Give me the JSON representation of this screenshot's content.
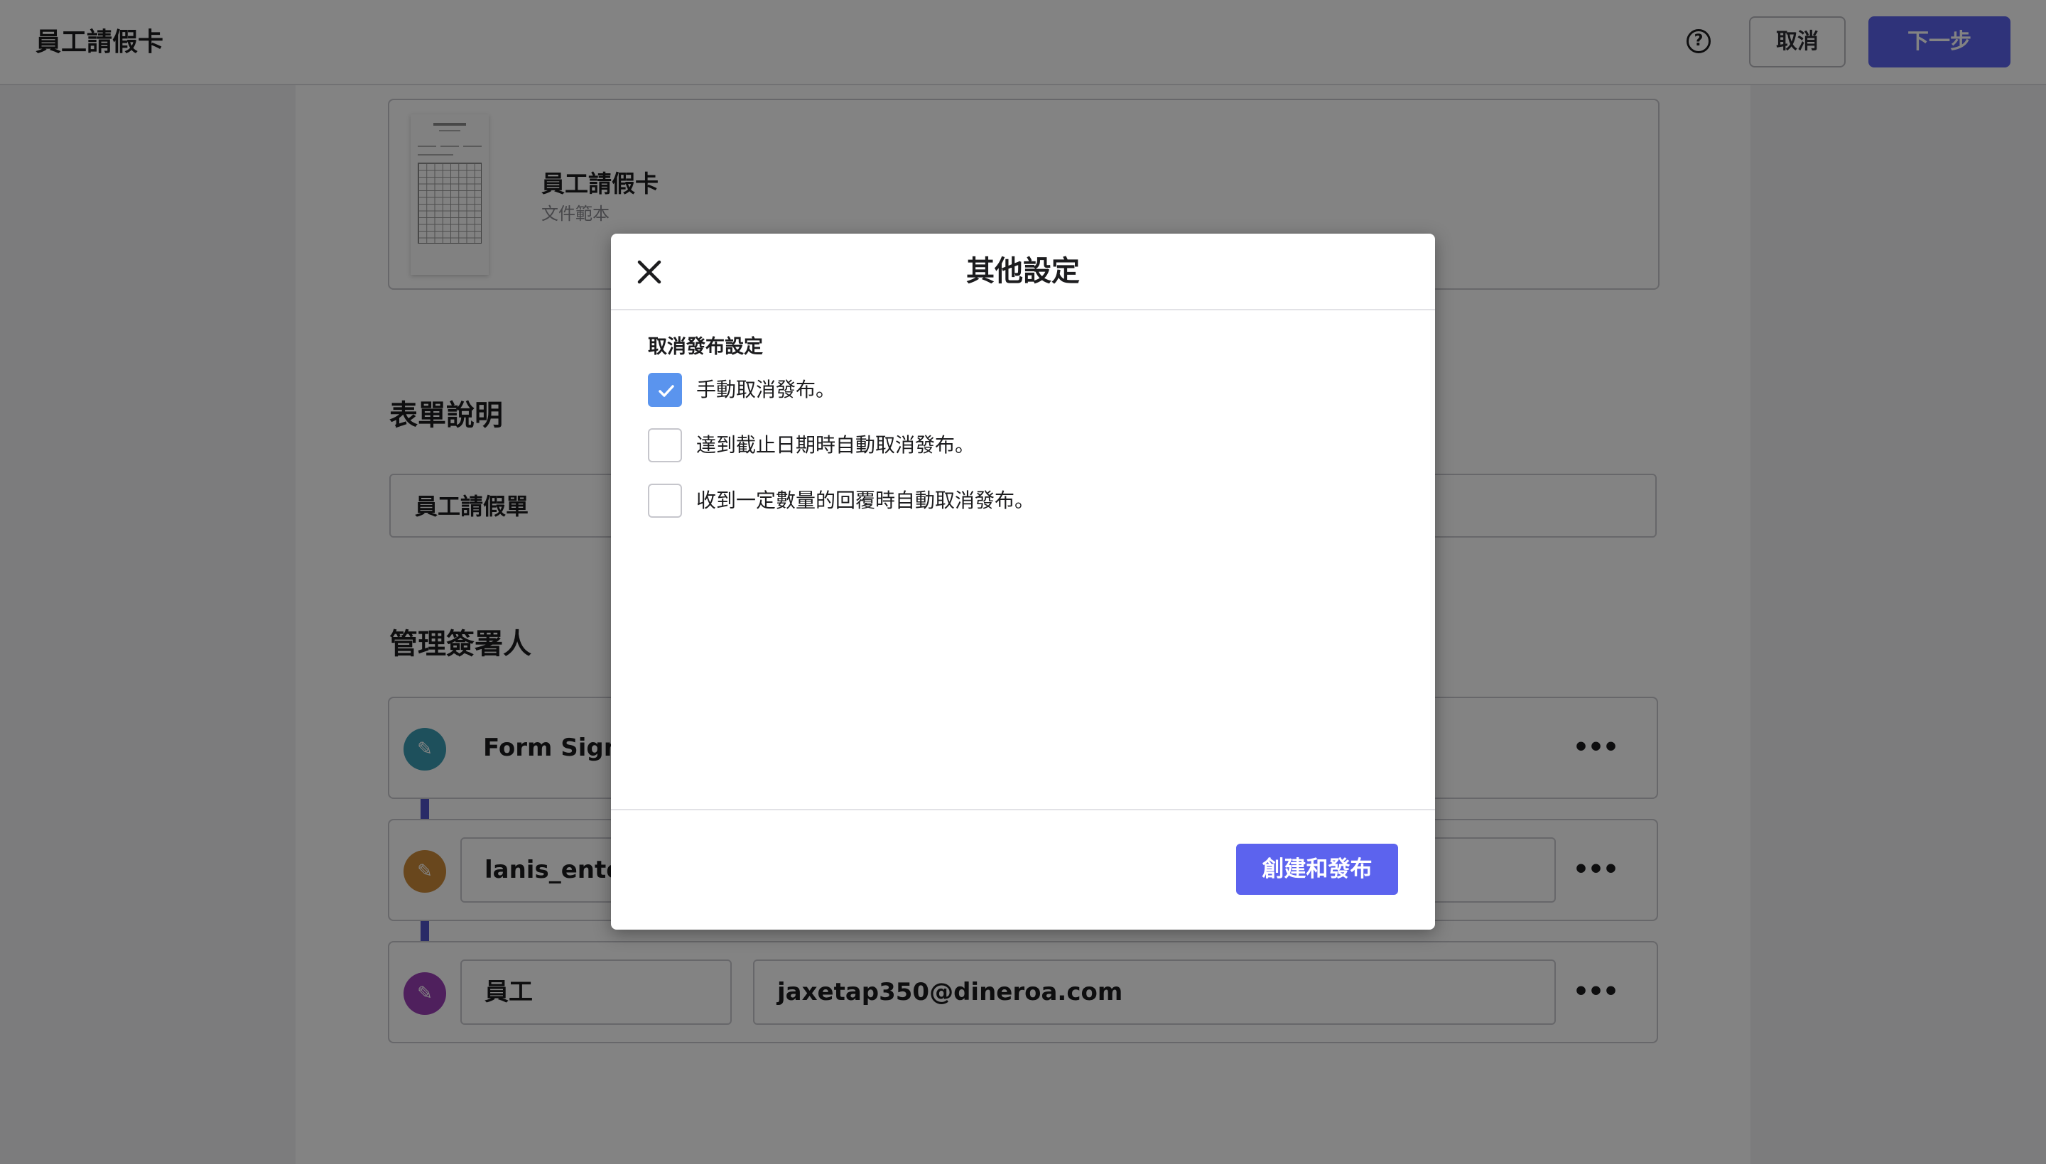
{
  "header": {
    "title": "員工請假卡",
    "help_icon_glyph": "?",
    "cancel_label": "取消",
    "next_label": "下一步"
  },
  "document": {
    "name": "員工請假卡",
    "subtitle": "文件範本"
  },
  "form_description": {
    "title": "表單說明",
    "value": "員工請假單"
  },
  "signers": {
    "title": "管理簽署人",
    "rows": [
      {
        "role": "Form Signer",
        "color": "#3b9db3",
        "icon": "pen-icon"
      },
      {
        "role": "lanis_enterprise",
        "color": "#cc8b3a",
        "icon": "pen-icon"
      },
      {
        "role": "員工",
        "email": "jaxetap350@dineroa.com",
        "color": "#9b3fb6",
        "icon": "pen-icon"
      }
    ],
    "more_glyph": "•••",
    "connector_color": "#5154c8"
  },
  "modal": {
    "title": "其他設定",
    "group_label": "取消發布設定",
    "options": [
      {
        "label": "手動取消發布。",
        "checked": true
      },
      {
        "label": "達到截止日期時自動取消發布。",
        "checked": false
      },
      {
        "label": "收到一定數量的回覆時自動取消發布。",
        "checked": false
      }
    ],
    "publish_label": "創建和發布",
    "accent_color": "#5c63ee",
    "checkbox_color": "#5a94ee"
  }
}
